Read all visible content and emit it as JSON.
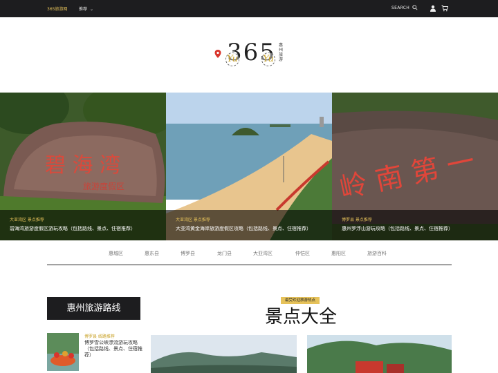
{
  "topbar": {
    "brand": "365旅游网",
    "nav_label": "推荐",
    "search_label": "SEARCH"
  },
  "logo": {
    "number": "365",
    "yu": "Yu",
    "side_text": "惠州旅游"
  },
  "hero": [
    {
      "category": "大亚湾区  景点推荐",
      "title": "碧海湾旅游度假区游玩攻略（包括路线、景点、住宿推荐）"
    },
    {
      "category": "大亚湾区  景点推荐",
      "title": "大亚湾黄金海岸旅游度假区攻略（包括路线、景点、住宿推荐）"
    },
    {
      "category": "博罗县  景点推荐",
      "title": "惠州罗浮山游玩攻略（包括路线、景点、住宿推荐）"
    }
  ],
  "categories": [
    "惠城区",
    "惠东县",
    "博罗县",
    "龙门县",
    "大亚湾区",
    "仲恺区",
    "惠阳区",
    "旅游百科"
  ],
  "routes": {
    "title": "惠州旅游路线",
    "items": [
      {
        "tag": "博罗县 线路推荐",
        "title": "博罗雪公峡漂流游玩攻略（包括路线、景点、住宿推荐）"
      }
    ]
  },
  "section": {
    "badge": "最受欢迎旅游热点",
    "title": "景点大全"
  },
  "colors": {
    "accent": "#e6c25a",
    "dark": "#1d1d1f"
  }
}
